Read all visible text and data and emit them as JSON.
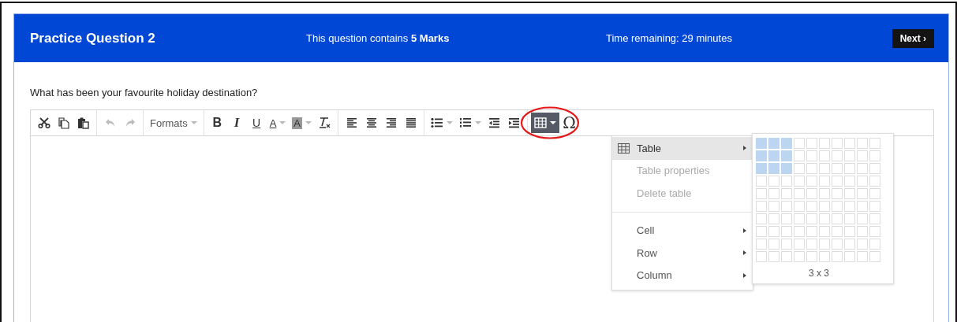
{
  "header": {
    "title": "Practice Question 2",
    "marks": "This question contains **5 Marks**",
    "timer": "Time remaining: 29 minutes",
    "next_button": "Next ›"
  },
  "question": "What has been your favourite holiday destination?",
  "toolbar": [
    {
      "group": [
        {
          "kind": "cut",
          "disabled": false,
          "caret": false,
          "active": false
        },
        {
          "kind": "copy",
          "disabled": false,
          "caret": false,
          "active": false
        },
        {
          "kind": "paste",
          "disabled": false,
          "caret": false,
          "active": false
        }
      ]
    },
    {
      "group": [
        {
          "kind": "undo",
          "disabled": true,
          "caret": false,
          "active": false
        },
        {
          "kind": "redo",
          "disabled": true,
          "caret": false,
          "active": false
        }
      ]
    },
    {
      "group": [
        {
          "kind": "formats",
          "label": "Formats",
          "disabled": false,
          "caret": true,
          "active": false
        }
      ]
    },
    {
      "group": [
        {
          "kind": "bold",
          "label": "B",
          "disabled": false,
          "caret": false,
          "active": false
        },
        {
          "kind": "italic",
          "label": "I",
          "disabled": false,
          "caret": false,
          "active": false
        },
        {
          "kind": "underline",
          "label": "U",
          "disabled": false,
          "caret": false,
          "active": false
        },
        {
          "kind": "forecolor",
          "label": "A",
          "disabled": false,
          "caret": true,
          "active": false
        },
        {
          "kind": "backcolor",
          "label": "A",
          "disabled": false,
          "caret": true,
          "active": false
        },
        {
          "kind": "clear",
          "disabled": false,
          "caret": false,
          "active": false
        }
      ]
    },
    {
      "group": [
        {
          "kind": "align-left",
          "disabled": false,
          "caret": false,
          "active": false
        },
        {
          "kind": "align-center",
          "disabled": false,
          "caret": false,
          "active": false
        },
        {
          "kind": "align-right",
          "disabled": false,
          "caret": false,
          "active": false
        },
        {
          "kind": "justify",
          "disabled": false,
          "caret": false,
          "active": false
        }
      ]
    },
    {
      "group": [
        {
          "kind": "bullets",
          "disabled": false,
          "caret": true,
          "active": false
        },
        {
          "kind": "numbers",
          "disabled": false,
          "caret": true,
          "active": false
        },
        {
          "kind": "outdent",
          "disabled": false,
          "caret": false,
          "active": false
        },
        {
          "kind": "indent",
          "disabled": false,
          "caret": false,
          "active": false
        }
      ]
    },
    {
      "group": [
        {
          "kind": "table",
          "disabled": false,
          "caret": true,
          "active": true,
          "circled": true
        },
        {
          "kind": "charmap",
          "label": "Ω",
          "disabled": false,
          "caret": false,
          "active": false
        }
      ]
    }
  ],
  "menu": {
    "items": [
      {
        "kind": "item",
        "label": "Table",
        "icon": true,
        "submenu": true,
        "selected": true,
        "disabled": false
      },
      {
        "kind": "item",
        "label": "Table properties",
        "icon": false,
        "submenu": false,
        "selected": false,
        "disabled": true
      },
      {
        "kind": "item",
        "label": "Delete table",
        "icon": false,
        "submenu": false,
        "selected": false,
        "disabled": true
      },
      {
        "kind": "divider"
      },
      {
        "kind": "item",
        "label": "Cell",
        "icon": false,
        "submenu": true,
        "selected": false,
        "disabled": false
      },
      {
        "kind": "item",
        "label": "Row",
        "icon": false,
        "submenu": true,
        "selected": false,
        "disabled": false
      },
      {
        "kind": "item",
        "label": "Column",
        "icon": false,
        "submenu": true,
        "selected": false,
        "disabled": false
      }
    ]
  },
  "grid_picker": {
    "size_label": "3 x 3",
    "rows": [
      [
        true,
        true,
        true,
        false,
        false,
        false,
        false,
        false,
        false,
        false
      ],
      [
        true,
        true,
        true,
        false,
        false,
        false,
        false,
        false,
        false,
        false
      ],
      [
        true,
        true,
        true,
        false,
        false,
        false,
        false,
        false,
        false,
        false
      ],
      [
        false,
        false,
        false,
        false,
        false,
        false,
        false,
        false,
        false,
        false
      ],
      [
        false,
        false,
        false,
        false,
        false,
        false,
        false,
        false,
        false,
        false
      ],
      [
        false,
        false,
        false,
        false,
        false,
        false,
        false,
        false,
        false,
        false
      ],
      [
        false,
        false,
        false,
        false,
        false,
        false,
        false,
        false,
        false,
        false
      ],
      [
        false,
        false,
        false,
        false,
        false,
        false,
        false,
        false,
        false,
        false
      ],
      [
        false,
        false,
        false,
        false,
        false,
        false,
        false,
        false,
        false,
        false
      ],
      [
        false,
        false,
        false,
        false,
        false,
        false,
        false,
        false,
        false,
        false
      ]
    ]
  }
}
